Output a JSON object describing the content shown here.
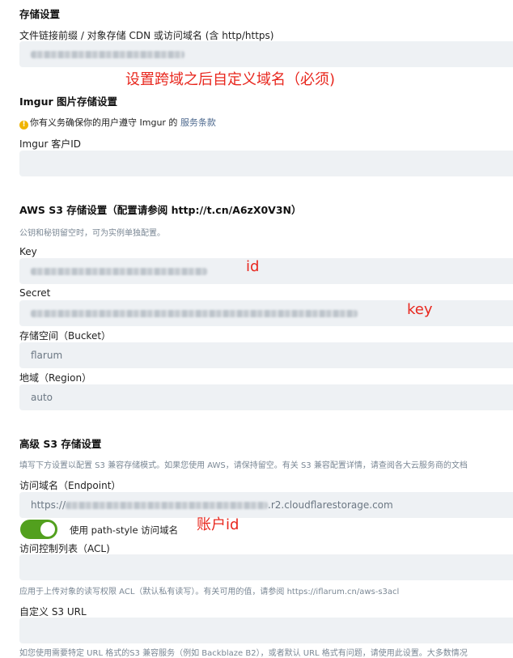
{
  "storage": {
    "title": "存储设置",
    "prefix_label": "文件链接前缀 / 对象存储 CDN 或访问域名 (含 http/https)",
    "annotation": "设置跨域之后自定义域名（必须)"
  },
  "imgur": {
    "title": "Imgur 图片存储设置",
    "notice_prefix": "你有义务确保你的用户遵守 Imgur 的",
    "notice_link": "服务条款",
    "client_id_label": "Imgur 客户ID"
  },
  "s3": {
    "title": "AWS S3 存储设置（配置请参阅 http://t.cn/A6zX0V3N）",
    "help": "公钥和秘钥留空时，可为实例单独配置。",
    "key_label": "Key",
    "key_annotation": "id",
    "secret_label": "Secret",
    "secret_annotation": "key",
    "bucket_label": "存储空间（Bucket）",
    "bucket_value": "flarum",
    "region_label": "地域（Region）",
    "region_value": "auto"
  },
  "advanced": {
    "title": "高级 S3 存储设置",
    "help": "填写下方设置以配置 S3 兼容存储模式。如果您使用 AWS，请保持留空。有关 S3 兼容配置详情，请查阅各大云服务商的文档",
    "endpoint_label": "访问域名（Endpoint）",
    "endpoint_prefix": "https://",
    "endpoint_suffix": ".r2.cloudflarestorage.com",
    "account_annotation": "账户id",
    "path_style_label": "使用 path-style 访问域名",
    "path_style_on": true,
    "acl_label": "访问控制列表（ACL)",
    "acl_help": "应用于上传对象的读写权限 ACL（默认私有读写）。有关可用的值，请参阅 https://iflarum.cn/aws-s3acl",
    "custom_url_label": "自定义 S3 URL",
    "custom_url_help": "如您使用需要特定 URL 格式的S3 兼容服务（例如 Backblaze B2），或者默认 URL 格式有问题，请使用此设置。大多数情况"
  },
  "colors": {
    "accent": "#52a01e",
    "annotation": "#e8271e",
    "input_bg": "#eef1f4",
    "link": "#4d698e"
  }
}
